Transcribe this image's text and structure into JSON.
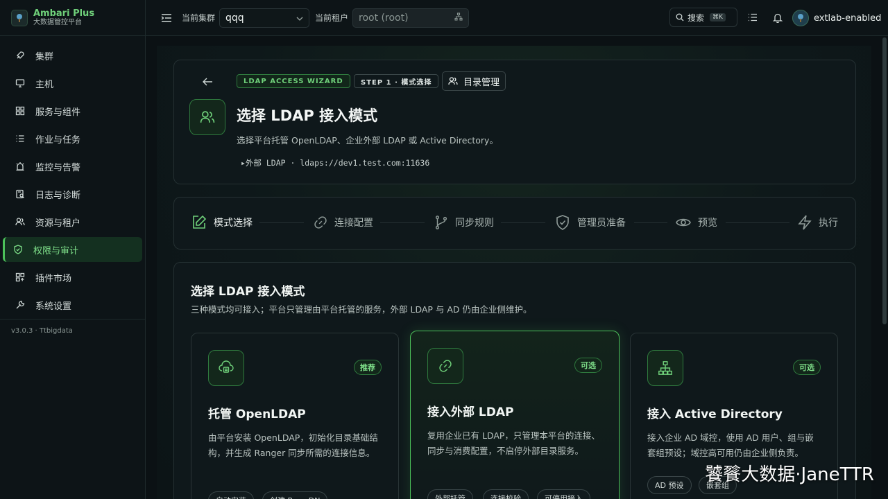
{
  "brand": {
    "title": "Ambari Plus",
    "subtitle": "大数据管控平台"
  },
  "sidebar": {
    "items": [
      {
        "label": "集群",
        "icon": "rocket-icon"
      },
      {
        "label": "主机",
        "icon": "monitor-icon"
      },
      {
        "label": "服务与组件",
        "icon": "grid-icon"
      },
      {
        "label": "作业与任务",
        "icon": "list-icon"
      },
      {
        "label": "监控与告警",
        "icon": "alarm-icon"
      },
      {
        "label": "日志与诊断",
        "icon": "log-icon"
      },
      {
        "label": "资源与租户",
        "icon": "users-icon"
      },
      {
        "label": "权限与审计",
        "icon": "shield-check-icon",
        "active": true
      },
      {
        "label": "插件市场",
        "icon": "puzzle-icon"
      },
      {
        "label": "系统设置",
        "icon": "wrench-icon"
      }
    ],
    "version": "v3.0.3 · Ttbigdata"
  },
  "topbar": {
    "cluster_label": "当前集群",
    "cluster_value": "qqq",
    "tenant_label": "当前租户",
    "tenant_value": "root (root)",
    "search_label": "搜索",
    "search_shortcut": "⌘K",
    "user_name": "extlab-enabled"
  },
  "header": {
    "badge_wizard": "LDAP ACCESS WIZARD",
    "badge_step": "STEP 1 · 模式选择",
    "directory_button": "目录管理",
    "title": "选择 LDAP 接入模式",
    "description": "选择平台托管 OpenLDAP、企业外部 LDAP 或 Active Directory。",
    "detail": "▸外部 LDAP · ldaps://dev1.test.com:11636"
  },
  "steps": [
    {
      "label": "模式选择",
      "icon": "edit-icon",
      "active": true
    },
    {
      "label": "连接配置",
      "icon": "link-icon"
    },
    {
      "label": "同步规则",
      "icon": "branch-icon"
    },
    {
      "label": "管理员准备",
      "icon": "shield-check-icon"
    },
    {
      "label": "预览",
      "icon": "eye-icon"
    },
    {
      "label": "执行",
      "icon": "bolt-icon"
    }
  ],
  "section": {
    "title": "选择 LDAP 接入模式",
    "subtitle": "三种模式均可接入；平台只管理由平台托管的服务，外部 LDAP 与 AD 仍由企业侧维护。"
  },
  "modes": [
    {
      "tag": "推荐",
      "title": "托管 OpenLDAP",
      "desc": "由平台安装 OpenLDAP，初始化目录基础结构，并生成 Ranger 同步所需的连接信息。",
      "pills": [
        "自动安装",
        "创建 Base DN"
      ],
      "icon": "cloud-server-icon"
    },
    {
      "tag": "可选",
      "title": "接入外部 LDAP",
      "desc": "复用企业已有 LDAP，只管理本平台的连接、同步与消费配置，不启停外部目录服务。",
      "pills": [
        "外部托管",
        "连接校验",
        "可停用接入"
      ],
      "icon": "link-icon",
      "selected": true
    },
    {
      "tag": "可选",
      "title": "接入 Active Directory",
      "desc": "接入企业 AD 域控，使用 AD 用户、组与嵌套组预设；域控高可用仍由企业侧负责。",
      "pills": [
        "AD 预设",
        "嵌套组"
      ],
      "icon": "network-icon"
    }
  ],
  "watermark": "饕餮大数据·JaneTTR",
  "colors": {
    "accent": "#4cc25a",
    "accent_text": "#6fd07a",
    "background": "#0b1114",
    "card": "#0f181b"
  }
}
